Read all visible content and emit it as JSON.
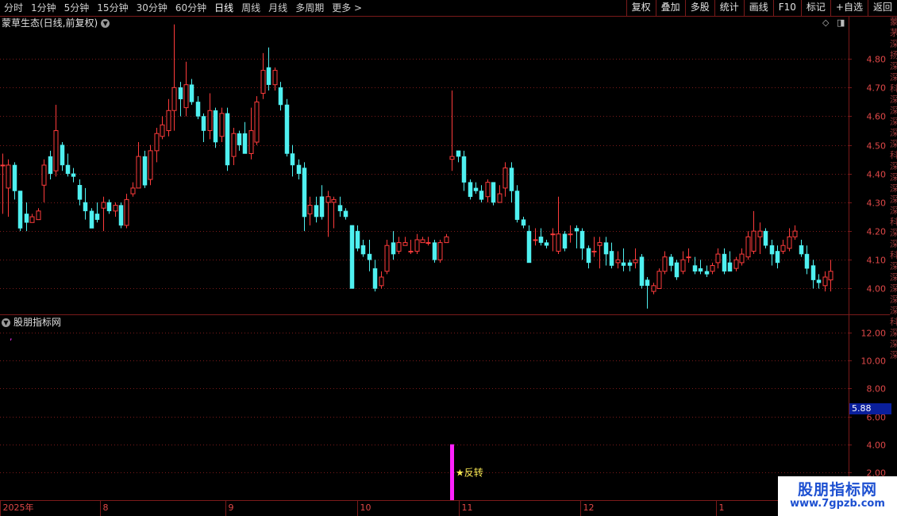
{
  "toolbar": {
    "periods": [
      "分时",
      "1分钟",
      "5分钟",
      "15分钟",
      "30分钟",
      "60分钟",
      "日线",
      "周线",
      "月线",
      "多周期",
      "更多 >"
    ],
    "active_period": "日线",
    "actions": [
      "复权",
      "叠加",
      "多股",
      "统计",
      "画线",
      "F10",
      "标记",
      "+自选",
      "返回"
    ]
  },
  "chart": {
    "title": "蒙草生态(日线,前复权)",
    "icons": [
      "diamond-icon",
      "window-icon"
    ]
  },
  "indicator": {
    "title": "股朋指标网",
    "signal_label": "★反转",
    "value_tag": "5.88"
  },
  "time_axis": [
    "2025年",
    "8",
    "9",
    "10",
    "11",
    "12",
    "1"
  ],
  "watermark": {
    "line1": "股朋指标网",
    "line2": "www.7gpzb.com"
  },
  "side_text": "蒙茅深扬深深科深深深深深科深深深深深科深深科深深深深深科深深深",
  "colors": {
    "up": "#ff3b3b",
    "down": "#4ff0f0",
    "grid": "#7a1a1a",
    "axis_text": "#e04848",
    "signal": "#ff22ff"
  },
  "chart_data": [
    {
      "type": "candlestick",
      "title": "蒙草生态(日线,前复权)",
      "y_ticks": [
        "4.80",
        "4.70",
        "4.60",
        "4.50",
        "4.40",
        "4.30",
        "4.20",
        "4.10",
        "4.00"
      ],
      "ylim": [
        3.91,
        4.9
      ],
      "candles": [
        [
          4.43,
          4.43,
          4.47,
          4.26
        ],
        [
          4.35,
          4.43,
          4.45,
          4.25
        ],
        [
          4.43,
          4.34,
          4.44,
          4.31
        ],
        [
          4.34,
          4.21,
          4.34,
          4.2
        ],
        [
          4.26,
          4.23,
          4.3,
          4.2
        ],
        [
          4.23,
          4.25,
          4.26,
          4.23
        ],
        [
          4.24,
          4.27,
          4.28,
          4.24
        ],
        [
          4.36,
          4.43,
          4.45,
          4.3
        ],
        [
          4.46,
          4.4,
          4.48,
          4.38
        ],
        [
          4.41,
          4.55,
          4.64,
          4.39
        ],
        [
          4.5,
          4.43,
          4.51,
          4.41
        ],
        [
          4.43,
          4.4,
          4.47,
          4.39
        ],
        [
          4.4,
          4.39,
          4.42,
          4.37
        ],
        [
          4.36,
          4.31,
          4.38,
          4.29
        ],
        [
          4.3,
          4.27,
          4.35,
          4.24
        ],
        [
          4.27,
          4.21,
          4.28,
          4.22
        ],
        [
          4.26,
          4.24,
          4.3,
          4.23
        ],
        [
          4.28,
          4.3,
          4.32,
          4.2
        ],
        [
          4.3,
          4.27,
          4.31,
          4.26
        ],
        [
          4.27,
          4.29,
          4.3,
          4.25
        ],
        [
          4.29,
          4.22,
          4.3,
          4.21
        ],
        [
          4.22,
          4.31,
          4.33,
          4.21
        ],
        [
          4.33,
          4.35,
          4.37,
          4.32
        ],
        [
          4.35,
          4.46,
          4.51,
          4.35
        ],
        [
          4.46,
          4.36,
          4.48,
          4.35
        ],
        [
          4.38,
          4.48,
          4.5,
          4.36
        ],
        [
          4.48,
          4.54,
          4.56,
          4.44
        ],
        [
          4.53,
          4.57,
          4.6,
          4.52
        ],
        [
          4.55,
          4.62,
          4.66,
          4.53
        ],
        [
          4.62,
          4.7,
          4.92,
          4.55
        ],
        [
          4.7,
          4.66,
          4.72,
          4.6
        ],
        [
          4.63,
          4.71,
          4.79,
          4.6
        ],
        [
          4.71,
          4.65,
          4.73,
          4.64
        ],
        [
          4.65,
          4.6,
          4.67,
          4.59
        ],
        [
          4.6,
          4.55,
          4.61,
          4.51
        ],
        [
          4.55,
          4.62,
          4.68,
          4.52
        ],
        [
          4.62,
          4.51,
          4.63,
          4.49
        ],
        [
          4.53,
          4.61,
          4.63,
          4.51
        ],
        [
          4.61,
          4.43,
          4.63,
          4.41
        ],
        [
          4.46,
          4.54,
          4.56,
          4.43
        ],
        [
          4.54,
          4.5,
          4.55,
          4.48
        ],
        [
          4.54,
          4.47,
          4.58,
          4.47
        ],
        [
          4.47,
          4.55,
          4.63,
          4.45
        ],
        [
          4.51,
          4.65,
          4.67,
          4.5
        ],
        [
          4.68,
          4.76,
          4.82,
          4.66
        ],
        [
          4.77,
          4.71,
          4.84,
          4.69
        ],
        [
          4.71,
          4.76,
          4.77,
          4.69
        ],
        [
          4.7,
          4.64,
          4.72,
          4.62
        ],
        [
          4.64,
          4.47,
          4.66,
          4.46
        ],
        [
          4.47,
          4.43,
          4.5,
          4.39
        ],
        [
          4.43,
          4.4,
          4.45,
          4.38
        ],
        [
          4.42,
          4.25,
          4.44,
          4.2
        ],
        [
          4.26,
          4.29,
          4.32,
          4.22
        ],
        [
          4.29,
          4.25,
          4.32,
          4.23
        ],
        [
          4.32,
          4.25,
          4.36,
          4.24
        ],
        [
          4.3,
          4.32,
          4.34,
          4.18
        ],
        [
          4.3,
          4.31,
          4.32,
          4.21
        ],
        [
          4.29,
          4.27,
          4.32,
          4.25
        ],
        [
          4.27,
          4.25,
          4.28,
          4.24
        ],
        [
          4.22,
          4.0,
          4.22,
          4.0
        ],
        [
          4.2,
          4.14,
          4.22,
          4.13
        ],
        [
          4.15,
          4.12,
          4.17,
          4.11
        ],
        [
          4.12,
          4.1,
          4.17,
          4.06
        ],
        [
          4.07,
          4.0,
          4.1,
          3.99
        ],
        [
          4.01,
          4.04,
          4.06,
          4.0
        ],
        [
          4.06,
          4.15,
          4.17,
          4.05
        ],
        [
          4.16,
          4.12,
          4.2,
          4.1
        ],
        [
          4.13,
          4.16,
          4.18,
          4.12
        ],
        [
          4.15,
          4.16,
          4.18,
          4.15
        ],
        [
          4.13,
          4.13,
          4.17,
          4.12
        ],
        [
          4.13,
          4.17,
          4.19,
          4.12
        ],
        [
          4.16,
          4.17,
          4.18,
          4.16
        ],
        [
          4.16,
          4.16,
          4.18,
          4.15
        ],
        [
          4.16,
          4.1,
          4.17,
          4.09
        ],
        [
          4.1,
          4.16,
          4.17,
          4.09
        ],
        [
          4.16,
          4.18,
          4.19,
          4.16
        ],
        [
          4.45,
          4.46,
          4.69,
          4.41
        ],
        [
          4.48,
          4.46,
          4.48,
          4.44
        ],
        [
          4.46,
          4.37,
          4.48,
          4.34
        ],
        [
          4.37,
          4.32,
          4.38,
          4.31
        ],
        [
          4.35,
          4.34,
          4.37,
          4.33
        ],
        [
          4.34,
          4.31,
          4.36,
          4.3
        ],
        [
          4.32,
          4.37,
          4.38,
          4.3
        ],
        [
          4.37,
          4.3,
          4.37,
          4.29
        ],
        [
          4.3,
          4.33,
          4.36,
          4.3
        ],
        [
          4.35,
          4.42,
          4.44,
          4.32
        ],
        [
          4.42,
          4.34,
          4.44,
          4.3
        ],
        [
          4.34,
          4.24,
          4.36,
          4.23
        ],
        [
          4.24,
          4.22,
          4.25,
          4.21
        ],
        [
          4.2,
          4.09,
          4.22,
          4.09
        ],
        [
          4.17,
          4.17,
          4.21,
          4.15
        ],
        [
          4.18,
          4.16,
          4.21,
          4.15
        ],
        [
          4.16,
          4.15,
          4.17,
          4.14
        ],
        [
          4.19,
          4.19,
          4.21,
          4.13
        ],
        [
          4.13,
          4.19,
          4.32,
          4.12
        ],
        [
          4.19,
          4.14,
          4.2,
          4.13
        ],
        [
          4.19,
          4.19,
          4.22,
          4.16
        ],
        [
          4.21,
          4.2,
          4.22,
          4.14
        ],
        [
          4.2,
          4.14,
          4.21,
          4.1
        ],
        [
          4.14,
          4.09,
          4.15,
          4.07
        ],
        [
          4.13,
          4.13,
          4.18,
          4.11
        ],
        [
          4.15,
          4.16,
          4.18,
          4.07
        ],
        [
          4.16,
          4.12,
          4.18,
          4.08
        ],
        [
          4.13,
          4.08,
          4.16,
          4.07
        ],
        [
          4.09,
          4.1,
          4.13,
          4.07
        ],
        [
          4.09,
          4.08,
          4.14,
          4.06
        ],
        [
          4.09,
          4.08,
          4.1,
          4.06
        ],
        [
          4.09,
          4.1,
          4.14,
          4.07
        ],
        [
          4.11,
          4.01,
          4.12,
          4.0
        ],
        [
          4.03,
          4.01,
          4.04,
          3.93
        ],
        [
          3.99,
          4.01,
          4.02,
          3.98
        ],
        [
          4.0,
          4.06,
          4.07,
          4.0
        ],
        [
          4.06,
          4.11,
          4.13,
          4.05
        ],
        [
          4.11,
          4.08,
          4.12,
          4.06
        ],
        [
          4.09,
          4.04,
          4.1,
          4.03
        ],
        [
          4.06,
          4.1,
          4.13,
          4.05
        ],
        [
          4.11,
          4.11,
          4.14,
          4.09
        ],
        [
          4.08,
          4.06,
          4.11,
          4.05
        ],
        [
          4.07,
          4.06,
          4.1,
          4.05
        ],
        [
          4.06,
          4.05,
          4.08,
          4.04
        ],
        [
          4.06,
          4.08,
          4.09,
          4.05
        ],
        [
          4.09,
          4.12,
          4.14,
          4.07
        ],
        [
          4.12,
          4.06,
          4.14,
          4.05
        ],
        [
          4.09,
          4.06,
          4.13,
          4.06
        ],
        [
          4.07,
          4.1,
          4.11,
          4.06
        ],
        [
          4.09,
          4.12,
          4.14,
          4.08
        ],
        [
          4.11,
          4.18,
          4.2,
          4.1
        ],
        [
          4.13,
          4.2,
          4.27,
          4.12
        ],
        [
          4.18,
          4.2,
          4.23,
          4.12
        ],
        [
          4.2,
          4.15,
          4.21,
          4.14
        ],
        [
          4.15,
          4.12,
          4.17,
          4.08
        ],
        [
          4.13,
          4.09,
          4.15,
          4.07
        ],
        [
          4.13,
          4.15,
          4.17,
          4.12
        ],
        [
          4.14,
          4.18,
          4.21,
          4.13
        ],
        [
          4.18,
          4.2,
          4.22,
          4.17
        ],
        [
          4.15,
          4.12,
          4.17,
          4.11
        ],
        [
          4.12,
          4.07,
          4.15,
          4.05
        ],
        [
          4.08,
          4.03,
          4.1,
          4.0
        ],
        [
          4.03,
          4.02,
          4.05,
          4.0
        ],
        [
          4.01,
          4.04,
          4.06,
          3.99
        ],
        [
          4.03,
          4.06,
          4.1,
          3.99
        ]
      ]
    },
    {
      "type": "bar",
      "title": "股朋指标网",
      "y_ticks": [
        "12.00",
        "10.00",
        "8.00",
        "6.00",
        "4.00",
        "2.00"
      ],
      "ylim": [
        0,
        13.2
      ],
      "signal_candle_index": 76,
      "values": [
        4.0
      ]
    }
  ]
}
